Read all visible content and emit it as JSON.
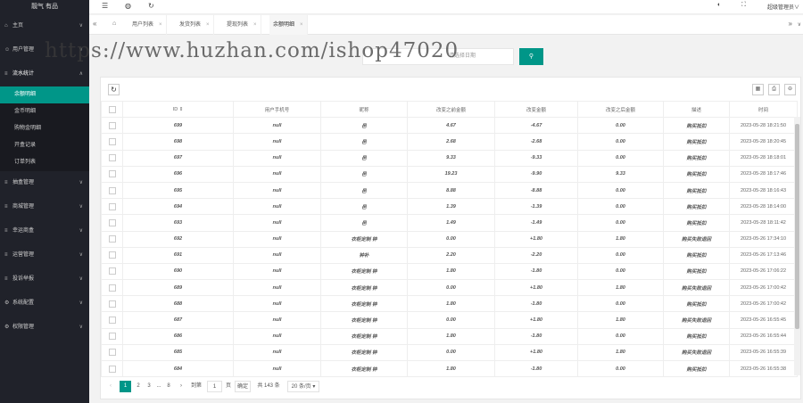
{
  "app": {
    "logo": "靓气 有品"
  },
  "sidebar": {
    "items": [
      {
        "label": "主页",
        "icon": "home-icon"
      },
      {
        "label": "用户管理",
        "icon": "user-icon"
      },
      {
        "label": "流水统计",
        "icon": "list-icon",
        "open": true
      },
      {
        "label": "抽盒管理",
        "icon": "list-icon"
      },
      {
        "label": "商城管理",
        "icon": "list-icon"
      },
      {
        "label": "幸运商盒",
        "icon": "list-icon"
      },
      {
        "label": "运营管理",
        "icon": "list-icon"
      },
      {
        "label": "投诉举报",
        "icon": "list-icon"
      },
      {
        "label": "系统配置",
        "icon": "gear-icon"
      },
      {
        "label": "权限管理",
        "icon": "gear-icon"
      }
    ],
    "sub_items": [
      "余额明细",
      "金币明细",
      "购物金明细",
      "开盒记录",
      "订单列表"
    ]
  },
  "header": {
    "user": "超级管理员"
  },
  "tabs": [
    "用户列表",
    "发货列表",
    "提现列表",
    "余额明细"
  ],
  "search": {
    "placeholder": "请选择日期",
    "watermark": "https://www.huzhan.com/ishop47020"
  },
  "table": {
    "columns": [
      "ID ⇕",
      "用户手机号",
      "昵称",
      "改变之前金额",
      "改变金额",
      "改变之后金额",
      "描述",
      "时间"
    ],
    "rows": [
      [
        "699",
        "null",
        "邑",
        "4.67",
        "-4.67",
        "0.00",
        "购买抵扣",
        "2023-05-28 18:21:50"
      ],
      [
        "698",
        "null",
        "邑",
        "2.68",
        "-2.68",
        "0.00",
        "购买抵扣",
        "2023-05-28 18:20:45"
      ],
      [
        "697",
        "null",
        "邑",
        "9.33",
        "-9.33",
        "0.00",
        "购买抵扣",
        "2023-05-28 18:18:01"
      ],
      [
        "696",
        "null",
        "邑",
        "19.23",
        "-9.90",
        "9.33",
        "购买抵扣",
        "2023-05-28 18:17:46"
      ],
      [
        "695",
        "null",
        "邑",
        "8.88",
        "-8.88",
        "0.00",
        "购买抵扣",
        "2023-05-28 18:16:43"
      ],
      [
        "694",
        "null",
        "邑",
        "1.39",
        "-1.39",
        "0.00",
        "购买抵扣",
        "2023-05-28 18:14:00"
      ],
      [
        "693",
        "null",
        "邑",
        "1.49",
        "-1.49",
        "0.00",
        "购买抵扣",
        "2023-05-28 18:11:42"
      ],
      [
        "692",
        "null",
        "衣柜定制 钟",
        "0.00",
        "+1.80",
        "1.80",
        "购买失败退回",
        "2023-05-26 17:34:10"
      ],
      [
        "691",
        "null",
        "钟补",
        "2.20",
        "-2.20",
        "0.00",
        "购买抵扣",
        "2023-05-26 17:13:46"
      ],
      [
        "690",
        "null",
        "衣柜定制 钟",
        "1.80",
        "-1.80",
        "0.00",
        "购买抵扣",
        "2023-05-26 17:06:22"
      ],
      [
        "689",
        "null",
        "衣柜定制 钟",
        "0.00",
        "+1.80",
        "1.80",
        "购买失败退回",
        "2023-05-26 17:00:42"
      ],
      [
        "688",
        "null",
        "衣柜定制 钟",
        "1.80",
        "-1.80",
        "0.00",
        "购买抵扣",
        "2023-05-26 17:00:42"
      ],
      [
        "687",
        "null",
        "衣柜定制 钟",
        "0.00",
        "+1.80",
        "1.80",
        "购买失败退回",
        "2023-05-26 16:55:45"
      ],
      [
        "686",
        "null",
        "衣柜定制 钟",
        "1.80",
        "-1.80",
        "0.00",
        "购买抵扣",
        "2023-05-26 16:55:44"
      ],
      [
        "685",
        "null",
        "衣柜定制 钟",
        "0.00",
        "+1.80",
        "1.80",
        "购买失败退回",
        "2023-05-26 16:55:39"
      ],
      [
        "684",
        "null",
        "衣柜定制 钟",
        "1.80",
        "-1.80",
        "0.00",
        "购买抵扣",
        "2023-05-26 16:55:38"
      ]
    ]
  },
  "pager": {
    "prev": "‹",
    "pages": [
      "1",
      "2",
      "3",
      "...",
      "8"
    ],
    "next": "›",
    "goto_label": "到第",
    "goto_value": "1",
    "page_unit": "页",
    "confirm": "确定",
    "total": "共 143 条",
    "page_size": "20 条/页"
  }
}
